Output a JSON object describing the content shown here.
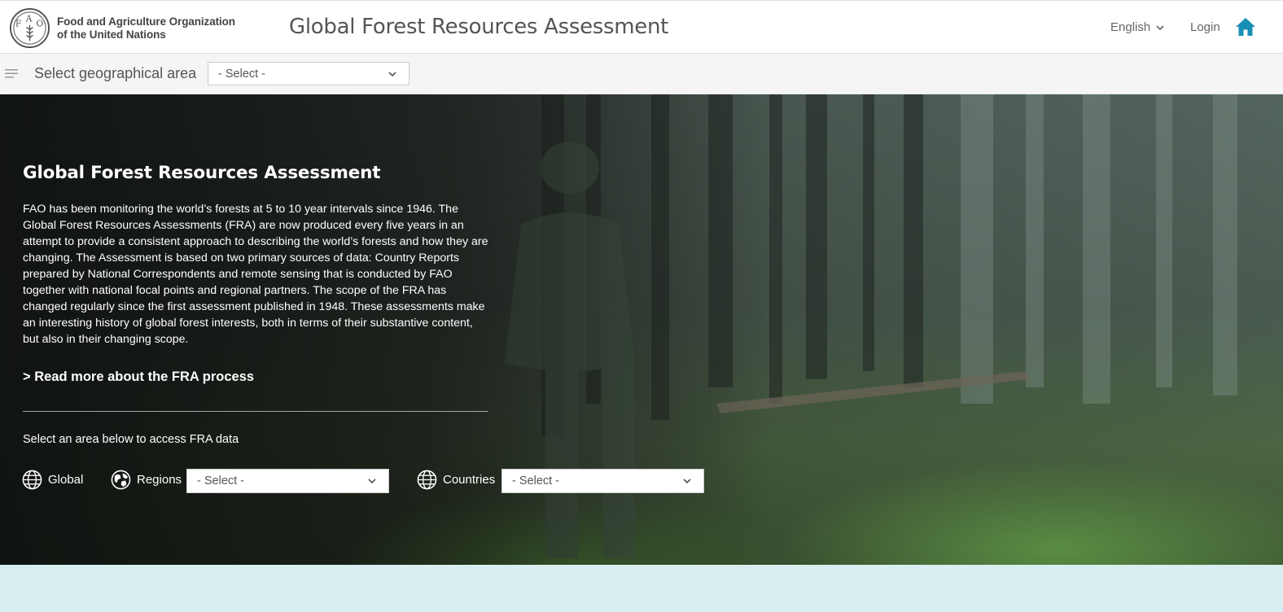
{
  "header": {
    "org_line1": "Food and Agriculture Organization",
    "org_line2": "of the United Nations",
    "logo_letters": "FAO",
    "site_title": "Global Forest Resources Assessment",
    "language": "English",
    "login": "Login",
    "home_icon": "home-icon",
    "accent_color": "#1a8fb5"
  },
  "subbar": {
    "label": "Select geographical area",
    "select_value": "- Select -"
  },
  "hero": {
    "title": "Global Forest Resources Assessment",
    "body": "FAO has been monitoring the world’s forests at 5 to 10 year intervals since 1946. The Global Forest Resources Assessments (FRA) are now produced every five years in an attempt to provide a consistent approach to describing the world’s forests and how they are changing. The Assessment is based on two primary sources of data: Country Reports prepared by National Correspondents and remote sensing that is conducted by FAO together with national focal points and regional partners. The scope of the FRA has changed regularly since the first assessment published in 1948. These assessments make an interesting history of global forest interests, both in terms of their substantive content, but also in their changing scope.",
    "read_more": "> Read more about the FRA process",
    "select_area_prompt": "Select an area below to access FRA data",
    "global_label": "Global",
    "regions_label": "Regions",
    "regions_select": "- Select -",
    "countries_label": "Countries",
    "countries_select": "- Select -"
  }
}
